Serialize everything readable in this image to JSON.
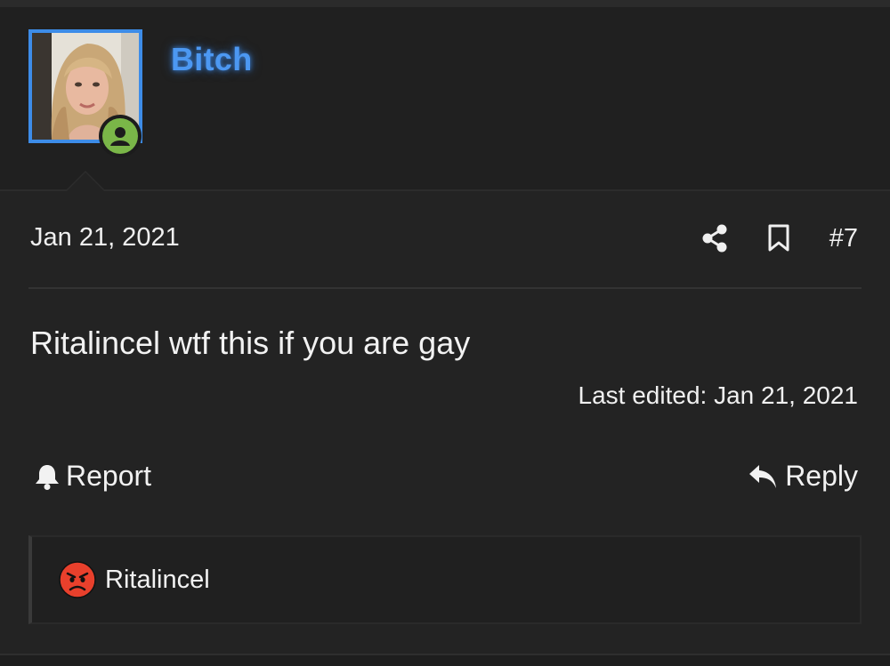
{
  "user": {
    "name": "Bitch",
    "name_color": "#4c98f2",
    "avatar_border_color": "#3d8ce8",
    "status_icon": "user-circle-icon",
    "status_color": "#7ab648"
  },
  "post": {
    "date": "Jan 21, 2021",
    "number": "#7",
    "message": "Ritalincel wtf this if you are gay",
    "last_edited": "Last edited: Jan 21, 2021",
    "actions": {
      "share_icon": "share-icon",
      "bookmark_icon": "bookmark-icon",
      "report_label": "Report",
      "report_icon": "bell-icon",
      "reply_label": "Reply",
      "reply_icon": "reply-arrow-icon"
    }
  },
  "reactions": {
    "emoji": "angry-face-icon",
    "users": "Ritalincel"
  }
}
